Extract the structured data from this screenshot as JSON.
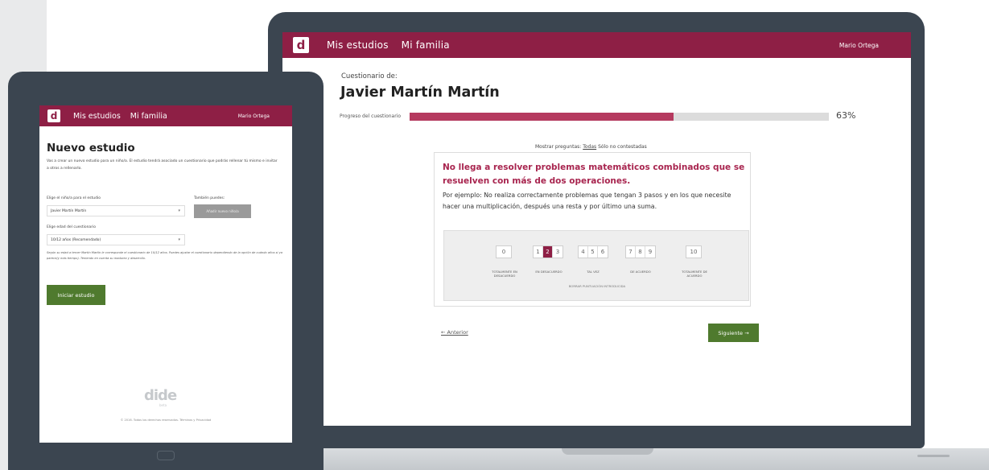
{
  "colors": {
    "brand": "#8e1f45",
    "accent_title": "#a8254f",
    "progress_fill": "#b53a5f",
    "button_green": "#4f7a2e",
    "device_frame": "#3b4550"
  },
  "laptop": {
    "nav": {
      "logo": "d",
      "links": [
        "Mis estudios",
        "Mi familia"
      ],
      "user": "Mario Ortega"
    },
    "questionnaire_label": "Cuestionario de:",
    "student_name": "Javier Martín Martín",
    "progress": {
      "label": "Progreso del cuestionario",
      "value": 63,
      "text": "63%"
    },
    "show_questions": {
      "prefix": "Mostrar preguntas:",
      "all": "Todas",
      "unanswered": "Sólo no contestadas"
    },
    "question": {
      "title": "No llega a resolver problemas matemáticos combinados que se resuelven con más de dos operaciones.",
      "example": "Por ejemplo: No realiza correctamente problemas que tengan 3 pasos y en los que necesite hacer una multiplicación, después una resta y por último una suma."
    },
    "scale": {
      "selected": 2,
      "groups": [
        {
          "values": [
            "0"
          ],
          "label": "TOTALMENTE EN DESACUERDO"
        },
        {
          "values": [
            "1",
            "2",
            "3"
          ],
          "label": "EN DESACUERDO"
        },
        {
          "values": [
            "4",
            "5",
            "6"
          ],
          "label": "TAL VEZ"
        },
        {
          "values": [
            "7",
            "8",
            "9"
          ],
          "label": "DE ACUERDO"
        },
        {
          "values": [
            "10"
          ],
          "label": "TOTALMENTE DE ACUERDO"
        }
      ],
      "footer": "BORRAR PUNTUACIÓN INTRODUCIDA"
    },
    "prev": "← Anterior",
    "next": "Siguiente →"
  },
  "tablet": {
    "nav": {
      "logo": "d",
      "links": [
        "Mis estudios",
        "Mi familia"
      ],
      "user": "Mario Ortega"
    },
    "title": "Nuevo estudio",
    "intro": "Vas a crear un nuevo estudio para un niño/a. El estudio tendrá asociado un cuestionario que podrás rellenar tú mismo e invitar a otros a rellenarlo.",
    "child_label": "Elige el niño/a para el estudio",
    "child_value": "Javier Martín Martín",
    "also_label": "También puedes:",
    "add_child": "Añadir nuevo niño/a",
    "age_label": "Elige edad del cuestionario",
    "age_value": "10/12 años (Recomendado)",
    "note": "Según su edad a tercer Martín Martín le corresponde el cuestionario de 10/12 años. Puedes ajustar el cuestionario dependiendo de la opción de cuándo años si ya parece(y más tiempo). Teniendo en cuenta su madurez y desarrollo.",
    "start": "Iniciar estudio",
    "logo": "dide",
    "logo_sub": "beta",
    "footer": "© 2016. Todos los derechos reservados. Términos y Privacidad"
  }
}
